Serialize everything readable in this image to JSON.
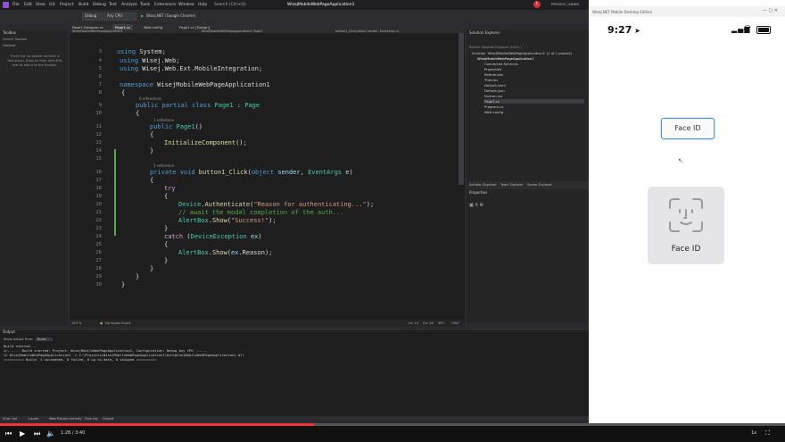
{
  "vs": {
    "menu": [
      "File",
      "Edit",
      "View",
      "Git",
      "Project",
      "Build",
      "Debug",
      "Test",
      "Analyze",
      "Tools",
      "Extensions",
      "Window",
      "Help"
    ],
    "search": "Search (Ctrl+Q)",
    "project_name": "WisejMobileWebPageApplication1",
    "user_badge": "L",
    "preview_label": "PREVIEW / ADMIN",
    "toolbar": {
      "config": "Debug",
      "platform": "Any CPU",
      "run": "Wisej.NET (Google Chrome)"
    },
    "toolbox": {
      "title": "Toolbox",
      "search": "Search Toolbox",
      "section": "General",
      "empty_text": "There are no usable controls in this group. Drag an item onto this text to add it to the toolbox."
    },
    "tabs": [
      "Page1.Designer.cs",
      "Page1.cs",
      "Web.config",
      "Page1.cs [Design]"
    ],
    "nav": {
      "left": "WisejMobileWebPageApplication1",
      "mid": "WisejMobileWebPageApplication1.Page1",
      "right": "button1_Click(object sender, EventArgs e)"
    },
    "code": {
      "line_numbers": [
        "3",
        "4",
        "5",
        "6",
        "7",
        "8",
        "9",
        "10",
        "11",
        "12",
        "13",
        "14",
        "15",
        "16",
        "17",
        "18",
        "19",
        "20",
        "21",
        "22",
        "23",
        "24",
        "25",
        "26",
        "27",
        "28",
        "29",
        "30"
      ],
      "refs": [
        "0 references",
        "1 reference",
        "1 reference"
      ]
    },
    "status": {
      "zoom": "150 %",
      "issues": "No issues found",
      "position": "Ln: 14",
      "col": "Ch: 16",
      "spc": "SPC",
      "crlf": "CRLF"
    },
    "solution": {
      "title": "Solution Explorer",
      "search": "Search Solution Explorer (Ctrl+;)",
      "root": "Solution 'WisejMobileWebPageApplication1' (1 of 1 project)",
      "items": [
        "WisejMobileWebPageApplication1",
        "Connected Services",
        "Properties",
        "References",
        "Themes",
        "Default.html",
        "Default.json",
        "favicon.ico",
        "Page1.cs",
        "Program.cs",
        "Web.config"
      ],
      "bottom_tabs": [
        "Solution Explorer",
        "Team Explorer",
        "Server Explorer"
      ]
    },
    "properties": {
      "title": "Properties"
    },
    "output": {
      "title": "Output",
      "show_from": "Show output from:",
      "source": "Build",
      "lines": [
        "Build started...",
        "1>------ Build started: Project: WisejMobileWebPageApplication1, Configuration: Debug Any CPU ------",
        "1>  WisejMobileWebPageApplication1 -> C:\\Projects\\WisejMobileWebPageApplication1\\bin\\WisejMobileWebPageApplication1.dll",
        "========== Build: 1 succeeded, 0 failed, 0 up-to-date, 0 skipped =========="
      ],
      "bottom_tabs": [
        "Error List",
        "Locals",
        "Web Publish Activity",
        "Find List",
        "Output"
      ]
    }
  },
  "phone": {
    "title": "Wisej.NET Mobile Desktop Edition",
    "time": "9:27",
    "face_id_button": "Face ID",
    "face_id_dialog_label": "Face ID"
  },
  "player": {
    "time": "1:28 / 3:40",
    "speed": "1x"
  },
  "colors": {
    "accent": "#007acc",
    "phone_button_border": "#4a90d9",
    "faceid_panel": "#e5e5e7"
  }
}
